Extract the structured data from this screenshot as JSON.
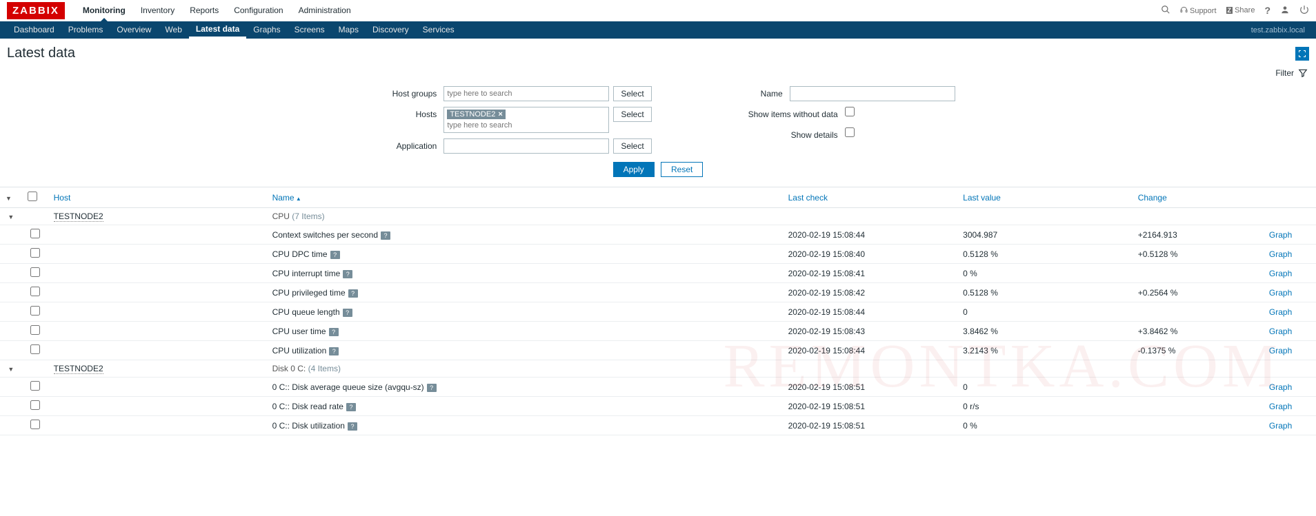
{
  "logo": "ZABBIX",
  "topnav": [
    "Monitoring",
    "Inventory",
    "Reports",
    "Configuration",
    "Administration"
  ],
  "topnav_active": 0,
  "top_right": {
    "support": "Support",
    "share": "Share"
  },
  "subnav": [
    "Dashboard",
    "Problems",
    "Overview",
    "Web",
    "Latest data",
    "Graphs",
    "Screens",
    "Maps",
    "Discovery",
    "Services"
  ],
  "subnav_active": 4,
  "server": "test.zabbix.local",
  "page_title": "Latest data",
  "filter": {
    "toggle": "Filter",
    "labels": {
      "hostgroups": "Host groups",
      "hosts": "Hosts",
      "application": "Application",
      "name": "Name",
      "without_data": "Show items without data",
      "details": "Show details"
    },
    "placeholders": {
      "search": "type here to search"
    },
    "hosts_tags": [
      "TESTNODE2"
    ],
    "select": "Select",
    "apply": "Apply",
    "reset": "Reset"
  },
  "columns": {
    "host": "Host",
    "name": "Name",
    "check": "Last check",
    "value": "Last value",
    "change": "Change"
  },
  "groups": [
    {
      "host": "TESTNODE2",
      "app": "CPU",
      "count": "(7 Items)",
      "rows": [
        {
          "name": "Context switches per second",
          "check": "2020-02-19 15:08:44",
          "value": "3004.987",
          "change": "+2164.913",
          "action": "Graph"
        },
        {
          "name": "CPU DPC time",
          "check": "2020-02-19 15:08:40",
          "value": "0.5128 %",
          "change": "+0.5128 %",
          "action": "Graph"
        },
        {
          "name": "CPU interrupt time",
          "check": "2020-02-19 15:08:41",
          "value": "0 %",
          "change": "",
          "action": "Graph"
        },
        {
          "name": "CPU privileged time",
          "check": "2020-02-19 15:08:42",
          "value": "0.5128 %",
          "change": "+0.2564 %",
          "action": "Graph"
        },
        {
          "name": "CPU queue length",
          "check": "2020-02-19 15:08:44",
          "value": "0",
          "change": "",
          "action": "Graph"
        },
        {
          "name": "CPU user time",
          "check": "2020-02-19 15:08:43",
          "value": "3.8462 %",
          "change": "+3.8462 %",
          "action": "Graph"
        },
        {
          "name": "CPU utilization",
          "check": "2020-02-19 15:08:44",
          "value": "3.2143 %",
          "change": "-0.1375 %",
          "action": "Graph"
        }
      ]
    },
    {
      "host": "TESTNODE2",
      "app": "Disk 0 C:",
      "count": "(4 Items)",
      "rows": [
        {
          "name": "0 C:: Disk average queue size (avgqu-sz)",
          "check": "2020-02-19 15:08:51",
          "value": "0",
          "change": "",
          "action": "Graph"
        },
        {
          "name": "0 C:: Disk read rate",
          "check": "2020-02-19 15:08:51",
          "value": "0 r/s",
          "change": "",
          "action": "Graph"
        },
        {
          "name": "0 C:: Disk utilization",
          "check": "2020-02-19 15:08:51",
          "value": "0 %",
          "change": "",
          "action": "Graph"
        }
      ]
    }
  ],
  "watermark": "REMONTKA.COM"
}
